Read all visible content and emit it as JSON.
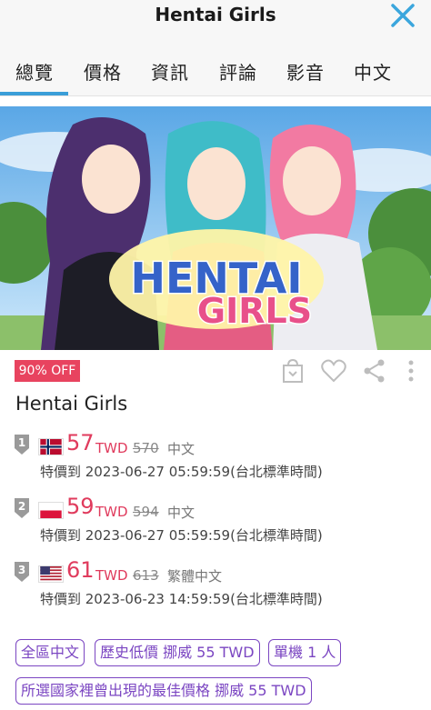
{
  "header": {
    "title": "Hentai Girls",
    "close_icon": "close-icon"
  },
  "tabs": [
    {
      "label": "總覽",
      "active": true
    },
    {
      "label": "價格"
    },
    {
      "label": "資訊"
    },
    {
      "label": "評論"
    },
    {
      "label": "影音"
    },
    {
      "label": "中文"
    }
  ],
  "hero": {
    "logo_line1": "HENTAI",
    "logo_line2": "GIRLS"
  },
  "discount_badge": "90% OFF",
  "action_icons": [
    "shopping-bag-icon",
    "heart-icon",
    "share-icon",
    "more-vertical-icon"
  ],
  "game_title": "Hentai Girls",
  "offers": [
    {
      "rank": "1",
      "flag": "norway",
      "price": "57",
      "currency": "TWD",
      "original": "570",
      "language": "中文",
      "until": "特價到 2023-06-27 05:59:59(台北標準時間)"
    },
    {
      "rank": "2",
      "flag": "poland",
      "price": "59",
      "currency": "TWD",
      "original": "594",
      "language": "中文",
      "until": "特價到 2023-06-27 05:59:59(台北標準時間)"
    },
    {
      "rank": "3",
      "flag": "usa",
      "price": "61",
      "currency": "TWD",
      "original": "613",
      "language": "繁體中文",
      "until": "特價到 2023-06-23 14:59:59(台北標準時間)"
    }
  ],
  "tags": [
    "全區中文",
    "歷史低價 挪威 55 TWD",
    "單機 1 人",
    "所選國家裡曾出現的最佳價格 挪威 55 TWD"
  ],
  "colors": {
    "accent": "#3b9ed8",
    "price": "#e03b5d",
    "badge": "#e8435f",
    "tag": "#7b46c2"
  }
}
